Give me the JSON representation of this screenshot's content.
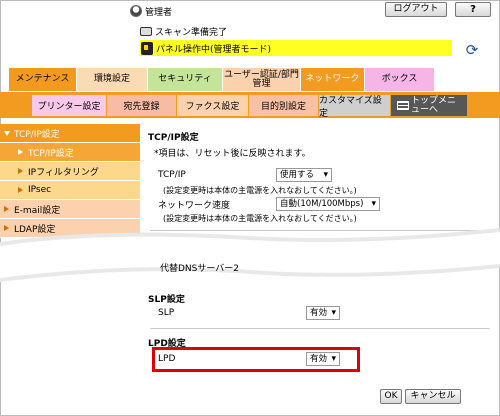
{
  "header": {
    "user_label": "管理者",
    "logout_label": "ログアウト",
    "help_label": "?",
    "status_scan": "スキャン準備完了",
    "status_panel": "パネル操作中(管理者モード)"
  },
  "main_tabs": [
    {
      "label": "メンテナンス"
    },
    {
      "label": "環境設定"
    },
    {
      "label": "セキュリティ"
    },
    {
      "label": "ユーザー認証/部門管理"
    },
    {
      "label": "ネットワーク"
    },
    {
      "label": "ボックス"
    }
  ],
  "sub_tabs": [
    {
      "label": "プリンター設定"
    },
    {
      "label": "宛先登録"
    },
    {
      "label": "ファクス設定"
    },
    {
      "label": "目的別設定"
    },
    {
      "label": "カスタマイズ設定"
    },
    {
      "label": "トップメニューへ"
    }
  ],
  "sidebar": {
    "items": [
      {
        "label": "TCP/IP設定"
      },
      {
        "label": "TCP/IP設定"
      },
      {
        "label": "IPフィルタリング"
      },
      {
        "label": "IPsec"
      },
      {
        "label": "E-mail設定"
      },
      {
        "label": "LDAP設定"
      }
    ]
  },
  "content": {
    "title": "TCP/IP設定",
    "note": "*項目は、リセット後に反映されます。",
    "tcpip_label": "TCP/IP",
    "tcpip_value": "使用する",
    "tcpip_hint": "(設定変更時は本体の主電源を入れなおしてください。)",
    "speed_label": "ネットワーク速度",
    "speed_value": "自動(10M/100Mbps)",
    "speed_hint": "(設定変更時は本体の主電源を入れなおしてください。)",
    "dns_label": "代替DNSサーバー2",
    "slp_title": "SLP設定",
    "slp_label": "SLP",
    "slp_value": "有効",
    "lpd_title": "LPD設定",
    "lpd_label": "LPD",
    "lpd_value": "有効"
  },
  "buttons": {
    "ok_label": "OK",
    "cancel_label": "キャンセル"
  }
}
